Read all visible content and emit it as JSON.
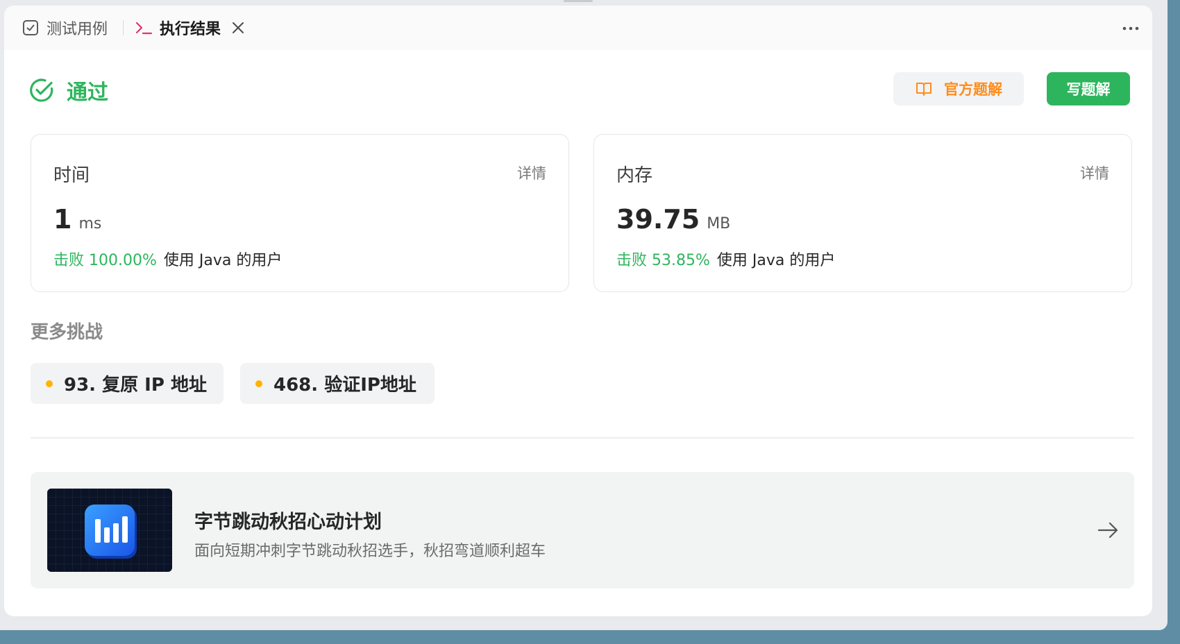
{
  "tabs": {
    "testcase_label": "测试用例",
    "result_label": "执行结果"
  },
  "status": {
    "text": "通过",
    "color": "#2db55d"
  },
  "actions": {
    "official_solution_label": "官方题解",
    "write_solution_label": "写题解"
  },
  "time_card": {
    "label": "时间",
    "detail_label": "详情",
    "value": "1",
    "unit": "ms",
    "beat_text": "击败 100.00%",
    "beat_suffix": "使用 Java 的用户"
  },
  "memory_card": {
    "label": "内存",
    "detail_label": "详情",
    "value": "39.75",
    "unit": "MB",
    "beat_text": "击败 53.85%",
    "beat_suffix": "使用 Java 的用户"
  },
  "more_challenges": {
    "title": "更多挑战",
    "items": [
      {
        "label": "93. 复原 IP 地址",
        "difficulty_color": "#ffb300"
      },
      {
        "label": "468. 验证IP地址",
        "difficulty_color": "#ffb300"
      }
    ]
  },
  "promo": {
    "title": "字节跳动秋招心动计划",
    "subtitle": "面向短期冲刺字节跳动秋招选手，秋招弯道顺利超车"
  },
  "colors": {
    "accent_green": "#2db55d",
    "accent_orange": "#ff8c1a",
    "result_tab_icon": "#e7336e"
  },
  "icons": {
    "testcase": "checkbox-icon",
    "result": "terminal-icon",
    "close": "close-icon",
    "more": "more-horizontal-icon",
    "status": "check-circle-icon",
    "official": "book-icon",
    "promo_arrow": "arrow-right-icon"
  }
}
